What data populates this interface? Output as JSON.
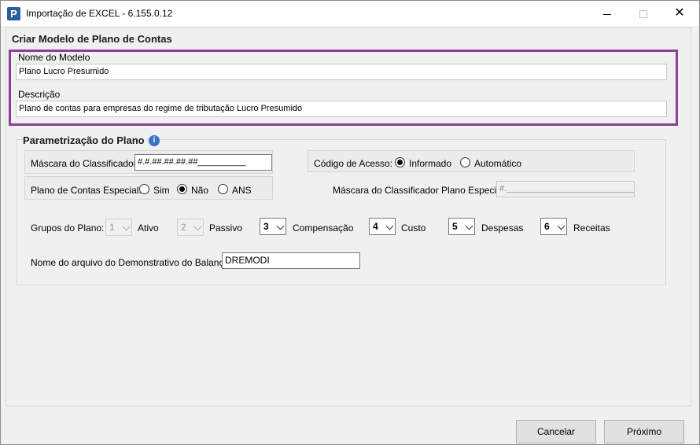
{
  "window": {
    "title": "Importação de EXCEL - 6.155.0.12",
    "app_icon": "P"
  },
  "criar_modelo": {
    "title": "Criar Modelo de Plano de Contas",
    "nome_label": "Nome do Modelo",
    "nome_value": "Plano Lucro Presumido",
    "descricao_label": "Descrição",
    "descricao_value": "Plano de contas para empresas do regime de tributação Lucro Presumido",
    "highlight_color": "#8e3d9b"
  },
  "parametrizacao": {
    "title": "Parametrização do Plano",
    "info_icon": "info-icon",
    "mascara_label": "Máscara do Classificador:",
    "mascara_value": "#.#.##.##.##.##__________",
    "codigo_acesso_label": "Código de Acesso:",
    "codigo_options": [
      {
        "label": "Informado",
        "checked": true
      },
      {
        "label": "Automático",
        "checked": false
      }
    ],
    "plano_especial_label": "Plano de Contas Especial:",
    "plano_especial_options": [
      {
        "label": "Sim",
        "checked": false
      },
      {
        "label": "Não",
        "checked": true
      },
      {
        "label": "ANS",
        "checked": false
      }
    ],
    "mascara_especial_label": "Máscara do Classificador Plano Especial:",
    "mascara_especial_value": "#._____________________________",
    "grupos_label": "Grupos do Plano:",
    "grupos": [
      {
        "number": "1",
        "label": "Ativo",
        "disabled": true
      },
      {
        "number": "2",
        "label": "Passivo",
        "disabled": true
      },
      {
        "number": "3",
        "label": "Compensação",
        "disabled": false
      },
      {
        "number": "4",
        "label": "Custo",
        "disabled": false
      },
      {
        "number": "5",
        "label": "Despesas",
        "disabled": false
      },
      {
        "number": "6",
        "label": "Receitas",
        "disabled": false
      }
    ],
    "arquivo_label": "Nome do arquivo do Demonstrativo do Balanço:",
    "arquivo_value": "DREMODI"
  },
  "buttons": {
    "cancelar_label": "Cancelar",
    "proximo_label": "Próximo"
  }
}
